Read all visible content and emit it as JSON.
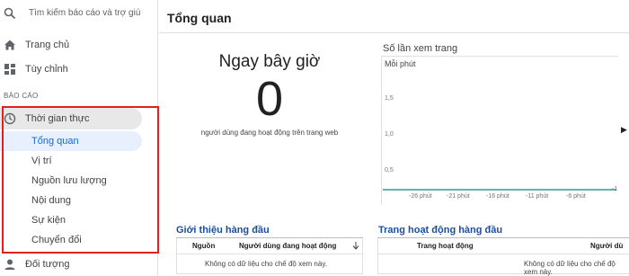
{
  "sidebar": {
    "search_placeholder": "Tìm kiếm báo cáo và trợ giú",
    "home": "Trang chủ",
    "customize": "Tùy chỉnh",
    "section": "BÁO CÁO",
    "realtime": "Thời gian thực",
    "sub_items": [
      "Tổng quan",
      "Vị trí",
      "Nguồn lưu lượng",
      "Nội dung",
      "Sự kiện",
      "Chuyển đổi"
    ],
    "audience": "Đối tượng"
  },
  "main": {
    "title": "Tổng quan",
    "now": {
      "title": "Ngay bây giờ",
      "value": "0",
      "desc": "người dùng đang hoạt động trên trang web"
    },
    "views": {
      "title": "Số lần xem trang",
      "per_min": "Mỗi phút",
      "y_ticks": [
        "1,5",
        "1,0",
        "0,5"
      ],
      "x_ticks": [
        "-26 phút",
        "-21 phút",
        "-16 phút",
        "-11 phút",
        "-6 phút"
      ],
      "edge_tick": "-1"
    },
    "top_referrals": {
      "title": "Giới thiệu hàng đầu",
      "col_source": "Nguồn",
      "col_active": "Người dùng đang hoạt động",
      "empty": "Không có dữ liệu cho chế độ xem này."
    },
    "top_pages": {
      "title": "Trang hoạt động hàng đầu",
      "col_page": "Trang hoạt động",
      "col_users": "Người dù",
      "empty": "Không có dữ liệu cho chế độ xem này."
    }
  },
  "colors": {
    "accent": "#1967d2",
    "highlight": "#e02020",
    "card_title": "#1a4fa0",
    "chart_base": "#00897b"
  }
}
